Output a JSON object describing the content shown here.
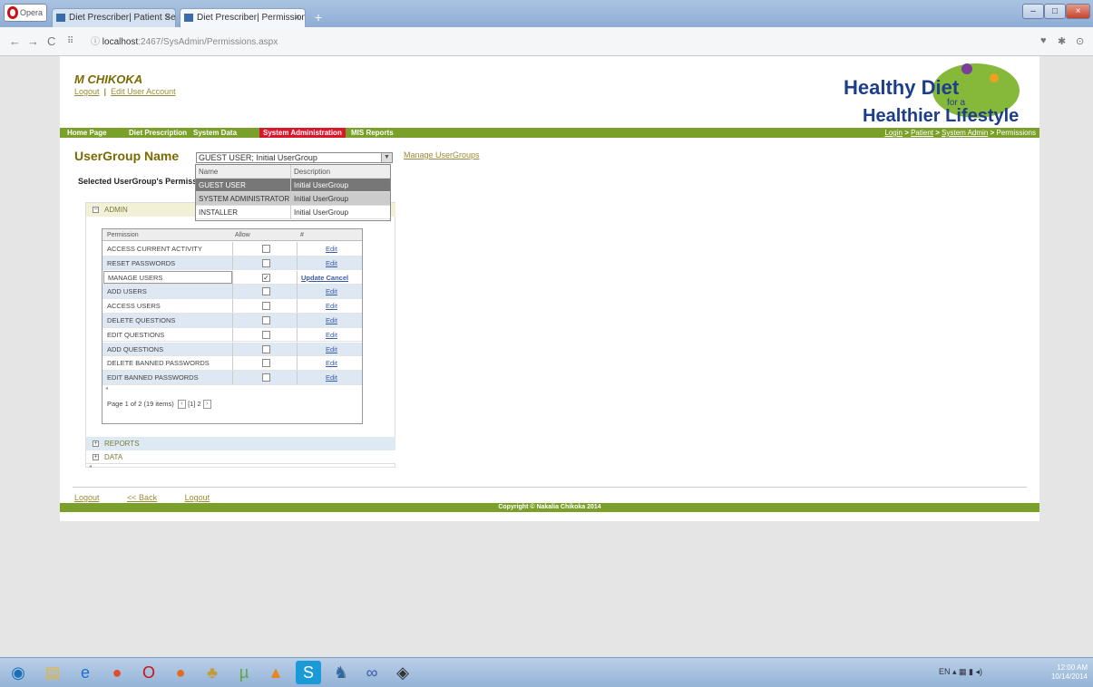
{
  "browser": {
    "app_button": "Opera",
    "tabs": [
      {
        "label": "Diet Prescriber| Patient Se"
      },
      {
        "label": "Diet Prescriber| Permission"
      }
    ],
    "new_tab": "+",
    "url_host": "localhost",
    "url_path": ":2467/SysAdmin/Permissions.aspx"
  },
  "header": {
    "user_name": "M CHIKOKA",
    "logout": "Logout",
    "separator": "|",
    "edit_account": "Edit User Account",
    "logo_line1": "Healthy Diet",
    "logo_line2": "for a",
    "logo_line3": "Healthier Lifestyle"
  },
  "nav": {
    "items": [
      "Home Page",
      "Diet Prescription",
      "System Data",
      "System Administration",
      "MIS Reports"
    ],
    "breadcrumb": [
      "Login",
      "Patient",
      "System Admin",
      "Permissions"
    ],
    "breadcrumb_sep": ">"
  },
  "usergroup": {
    "label": "UserGroup Name",
    "selected_value": "GUEST USER; Initial UserGroup",
    "manage_link": "Manage UserGroups",
    "selected_perm_label": "Selected UserGroup's Permissions",
    "dropdown": {
      "headers": [
        "Name",
        "Description"
      ],
      "rows": [
        {
          "name": "GUEST USER",
          "description": "Initial UserGroup"
        },
        {
          "name": "SYSTEM ADMINISTRATOR",
          "description": "Initial UserGroup"
        },
        {
          "name": "INSTALLER",
          "description": "Initial UserGroup"
        }
      ]
    }
  },
  "tree": {
    "nodes": [
      "ADMIN",
      "REPORTS",
      "DATA"
    ],
    "expanded_sign": "−",
    "collapsed_sign": "+"
  },
  "grid": {
    "headers": [
      "Permission",
      "Allow",
      "#"
    ],
    "rows": [
      {
        "permission": "ACCESS CURRENT ACTIVITY",
        "action": "Edit"
      },
      {
        "permission": "RESET PASSWORDS",
        "action": "Edit"
      },
      {
        "permission": "MANAGE USERS",
        "update": "Update",
        "cancel": "Cancel"
      },
      {
        "permission": "ADD USERS",
        "action": "Edit"
      },
      {
        "permission": "ACCESS USERS",
        "action": "Edit"
      },
      {
        "permission": "DELETE QUESTIONS",
        "action": "Edit"
      },
      {
        "permission": "EDIT QUESTIONS",
        "action": "Edit"
      },
      {
        "permission": "ADD QUESTIONS",
        "action": "Edit"
      },
      {
        "permission": "DELETE BANNED PASSWORDS",
        "action": "Edit"
      },
      {
        "permission": "EDIT BANNED PASSWORDS",
        "action": "Edit"
      }
    ],
    "pager_text": "Page 1 of 2 (19 items)",
    "pages": [
      "[1]",
      "2"
    ]
  },
  "footer": {
    "links": [
      "Logout",
      "<< Back",
      "Logout"
    ],
    "copyright": "Copyright © Nakalia Chikoka 2014"
  },
  "taskbar": {
    "lang": "EN",
    "time": "12:00 AM",
    "date": "10/14/2014"
  }
}
